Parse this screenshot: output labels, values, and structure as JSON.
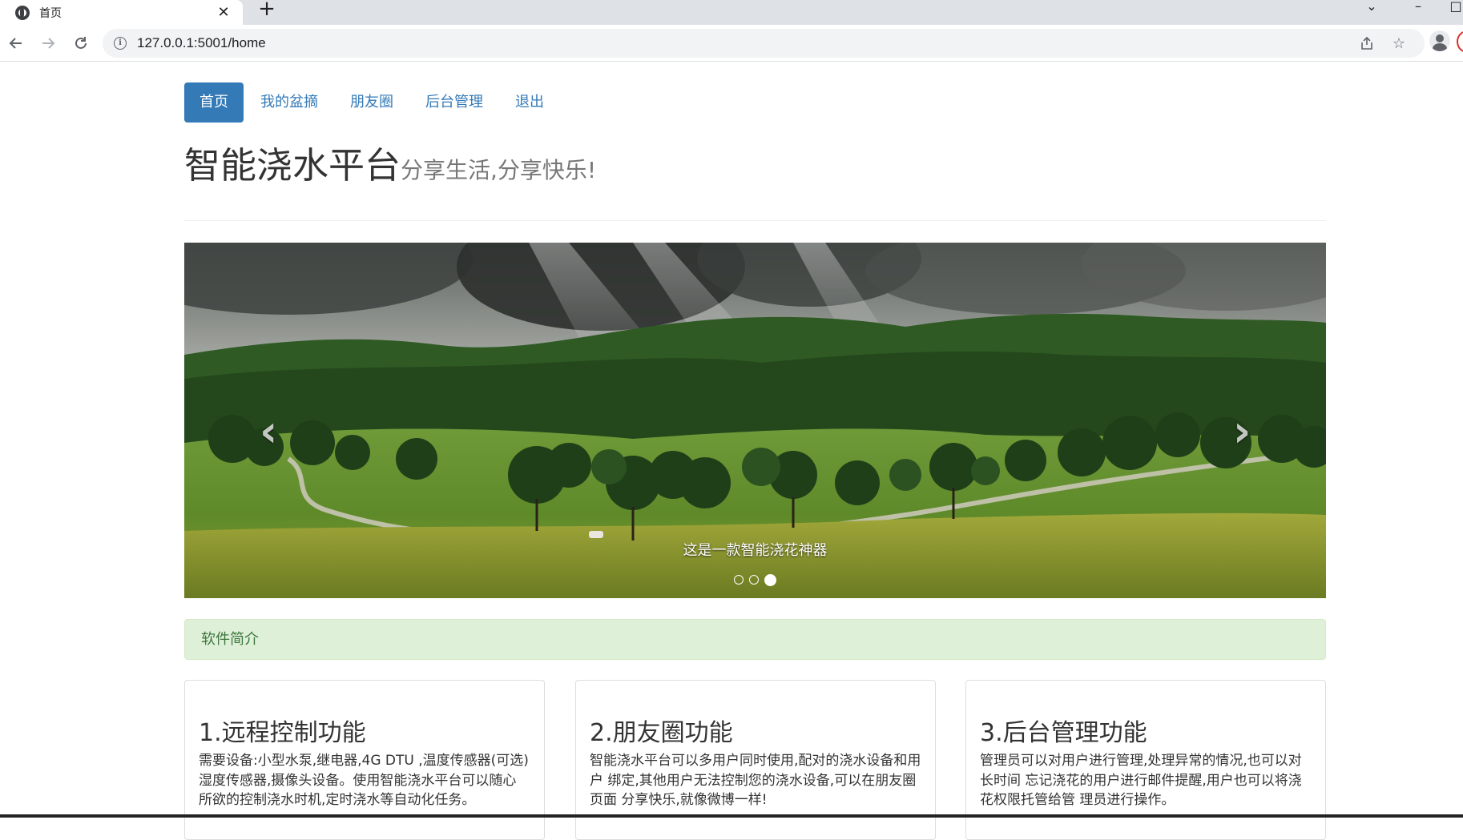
{
  "browser": {
    "tab_title": "首页",
    "tab_close": "✕",
    "new_tab": "+",
    "url": "127.0.0.1:5001/home",
    "icons": [
      "globe-icon",
      "close-icon",
      "plus-icon",
      "back-icon",
      "forward-icon",
      "reload-icon",
      "info-icon",
      "share-icon",
      "star-icon",
      "profile-icon"
    ]
  },
  "nav": {
    "items": [
      {
        "label": "首页",
        "active": true
      },
      {
        "label": "我的盆摘",
        "active": false
      },
      {
        "label": "朋友圈",
        "active": false
      },
      {
        "label": "后台管理",
        "active": false
      },
      {
        "label": "退出",
        "active": false
      }
    ]
  },
  "header": {
    "title": "智能浇水平台",
    "subtitle": "分享生活,分享快乐!"
  },
  "carousel": {
    "caption": "这是一款智能浇花神器",
    "prev_icon": "chevron-left-icon",
    "next_icon": "chevron-right-icon",
    "slide_count": 3,
    "active_index": 2
  },
  "alert": {
    "text": "软件简介"
  },
  "features": [
    {
      "title": "1.远程控制功能",
      "text": "需要设备:小型水泵,继电器,4G DTU ,温度传感器(可选) 湿度传感器,摄像头设备。使用智能浇水平台可以随心 所欲的控制浇水时机,定时浇水等自动化任务。"
    },
    {
      "title": "2.朋友圈功能",
      "text": "智能浇水平台可以多用户同时使用,配对的浇水设备和用户 绑定,其他用户无法控制您的浇水设备,可以在朋友圈页面 分享快乐,就像微博一样!"
    },
    {
      "title": "3.后台管理功能",
      "text": "管理员可以对用户进行管理,处理异常的情况,也可以对长时间 忘记浇花的用户进行邮件提醒,用户也可以将浇花权限托管给管 理员进行操作。"
    }
  ],
  "colors": {
    "primary": "#337ab7",
    "alert_bg": "#dff0d8",
    "alert_text": "#3c763d"
  }
}
